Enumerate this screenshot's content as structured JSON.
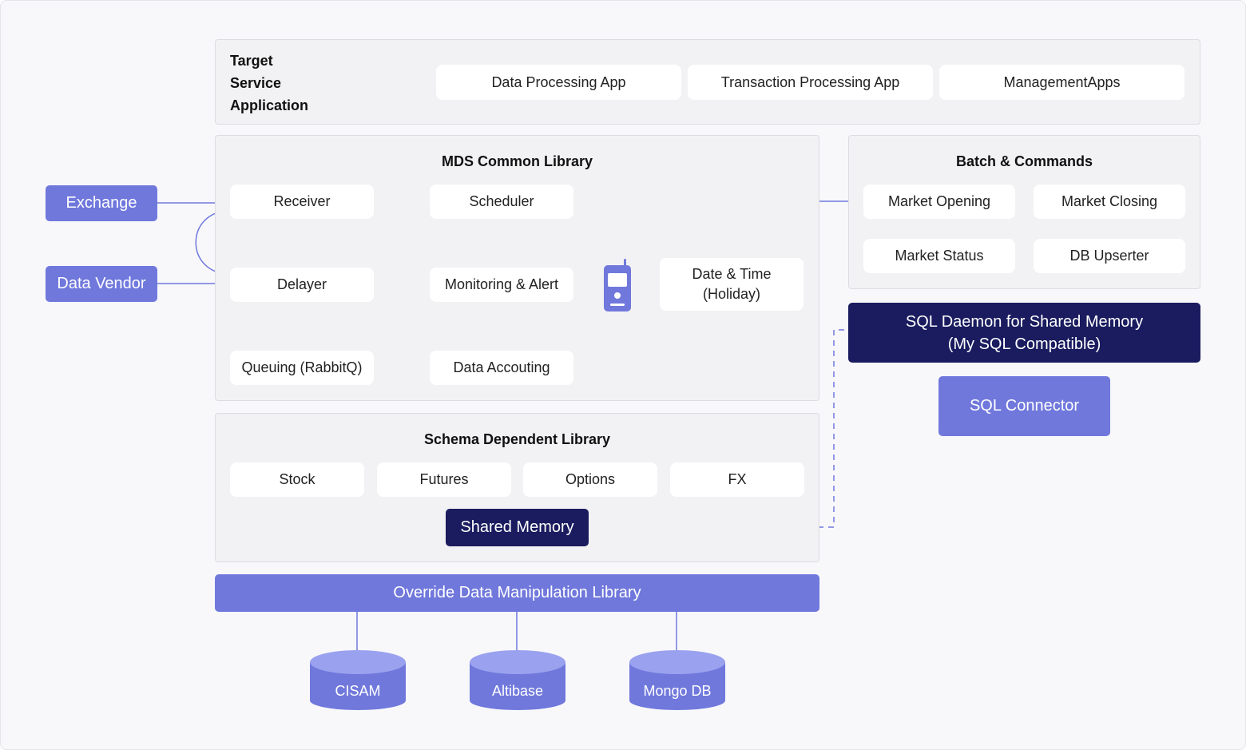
{
  "target": {
    "title_lines": [
      "Target",
      "Service",
      "Application"
    ],
    "apps": [
      "Data Processing App",
      "Transaction Processing App",
      "ManagementApps"
    ]
  },
  "sources": {
    "exchange": "Exchange",
    "data_vendor": "Data Vendor"
  },
  "mds": {
    "title": "MDS Common Library",
    "receiver": "Receiver",
    "delayer": "Delayer",
    "queuing": "Queuing (RabbitQ)",
    "scheduler": "Scheduler",
    "monitoring": "Monitoring & Alert",
    "data_accouting": "Data Accouting",
    "datetime_line1": "Date & Time",
    "datetime_line2": "(Holiday)"
  },
  "batch": {
    "title": "Batch & Commands",
    "items": [
      "Market Opening",
      "Market Closing",
      "Market Status",
      "DB Upserter"
    ]
  },
  "sql": {
    "daemon_line1": "SQL Daemon for Shared Memory",
    "daemon_line2": "(My SQL Compatible)",
    "connector": "SQL Connector"
  },
  "schema": {
    "title": "Schema Dependent Library",
    "items": [
      "Stock",
      "Futures",
      "Options",
      "FX"
    ],
    "shared_memory": "Shared Memory"
  },
  "override": {
    "title": "Override Data Manipulation Library"
  },
  "databases": [
    "CISAM",
    "Altibase",
    "Mongo DB"
  ],
  "icons": {
    "walkie": "walkie-talkie-icon",
    "database": "database-cylinder-icon"
  },
  "colors": {
    "accent": "#7078dc",
    "dark": "#1a1c5f",
    "db_top": "#9aa1ee",
    "panel": "#f2f2f4"
  }
}
